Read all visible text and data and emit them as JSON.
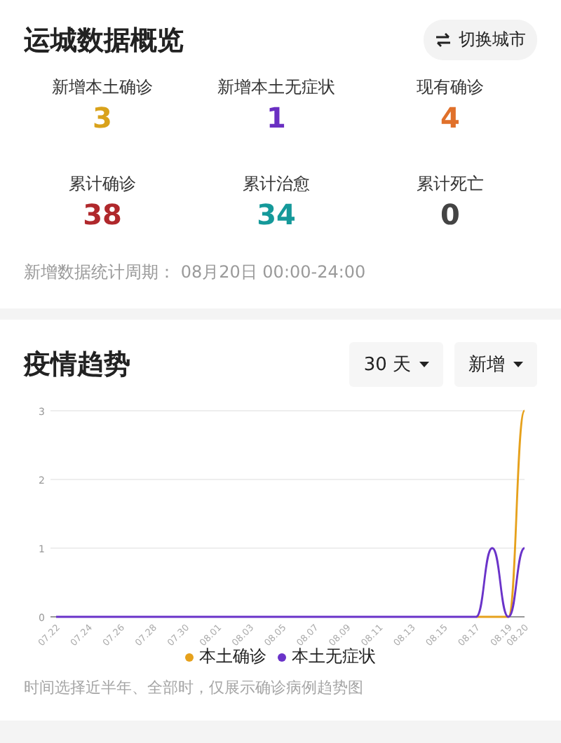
{
  "overview": {
    "title": "运城数据概览",
    "switch_button": "切换城市",
    "stats": [
      {
        "label": "新增本土确诊",
        "value": "3",
        "color": "#d9a21b"
      },
      {
        "label": "新增本土无症状",
        "value": "1",
        "color": "#6a2fc2"
      },
      {
        "label": "现有确诊",
        "value": "4",
        "color": "#e0702a"
      },
      {
        "label": "累计确诊",
        "value": "38",
        "color": "#b0282c"
      },
      {
        "label": "累计治愈",
        "value": "34",
        "color": "#15999a"
      },
      {
        "label": "累计死亡",
        "value": "0",
        "color": "#444444"
      }
    ],
    "period_note": "新增数据统计周期： 08月20日 00:00-24:00"
  },
  "trend": {
    "title": "疫情趋势",
    "range_dropdown": "30 天",
    "type_dropdown": "新增",
    "chart_data": {
      "type": "line",
      "categories": [
        "07.22",
        null,
        "07.24",
        null,
        "07.26",
        null,
        "07.28",
        null,
        "07.30",
        null,
        "08.01",
        null,
        "08.03",
        null,
        "08.05",
        null,
        "08.07",
        null,
        "08.09",
        null,
        "08.11",
        null,
        "08.13",
        null,
        "08.15",
        null,
        "08.17",
        null,
        "08.19",
        "08.20"
      ],
      "series": [
        {
          "name": "本土确诊",
          "color": "#e6a11c",
          "values": [
            null,
            null,
            null,
            null,
            null,
            null,
            null,
            null,
            null,
            null,
            null,
            null,
            null,
            null,
            null,
            null,
            null,
            null,
            null,
            null,
            null,
            null,
            null,
            null,
            null,
            null,
            0,
            0,
            0,
            3
          ]
        },
        {
          "name": "本土无症状",
          "color": "#6a33c9",
          "values": [
            0,
            0,
            0,
            0,
            0,
            0,
            0,
            0,
            0,
            0,
            0,
            0,
            0,
            0,
            0,
            0,
            0,
            0,
            0,
            0,
            0,
            0,
            0,
            0,
            0,
            0,
            0,
            1,
            0,
            1
          ]
        }
      ],
      "ylim": [
        0,
        3
      ],
      "yticks": [
        0,
        1,
        2,
        3
      ]
    },
    "note": "时间选择近半年、全部时，仅展示确诊病例趋势图"
  }
}
